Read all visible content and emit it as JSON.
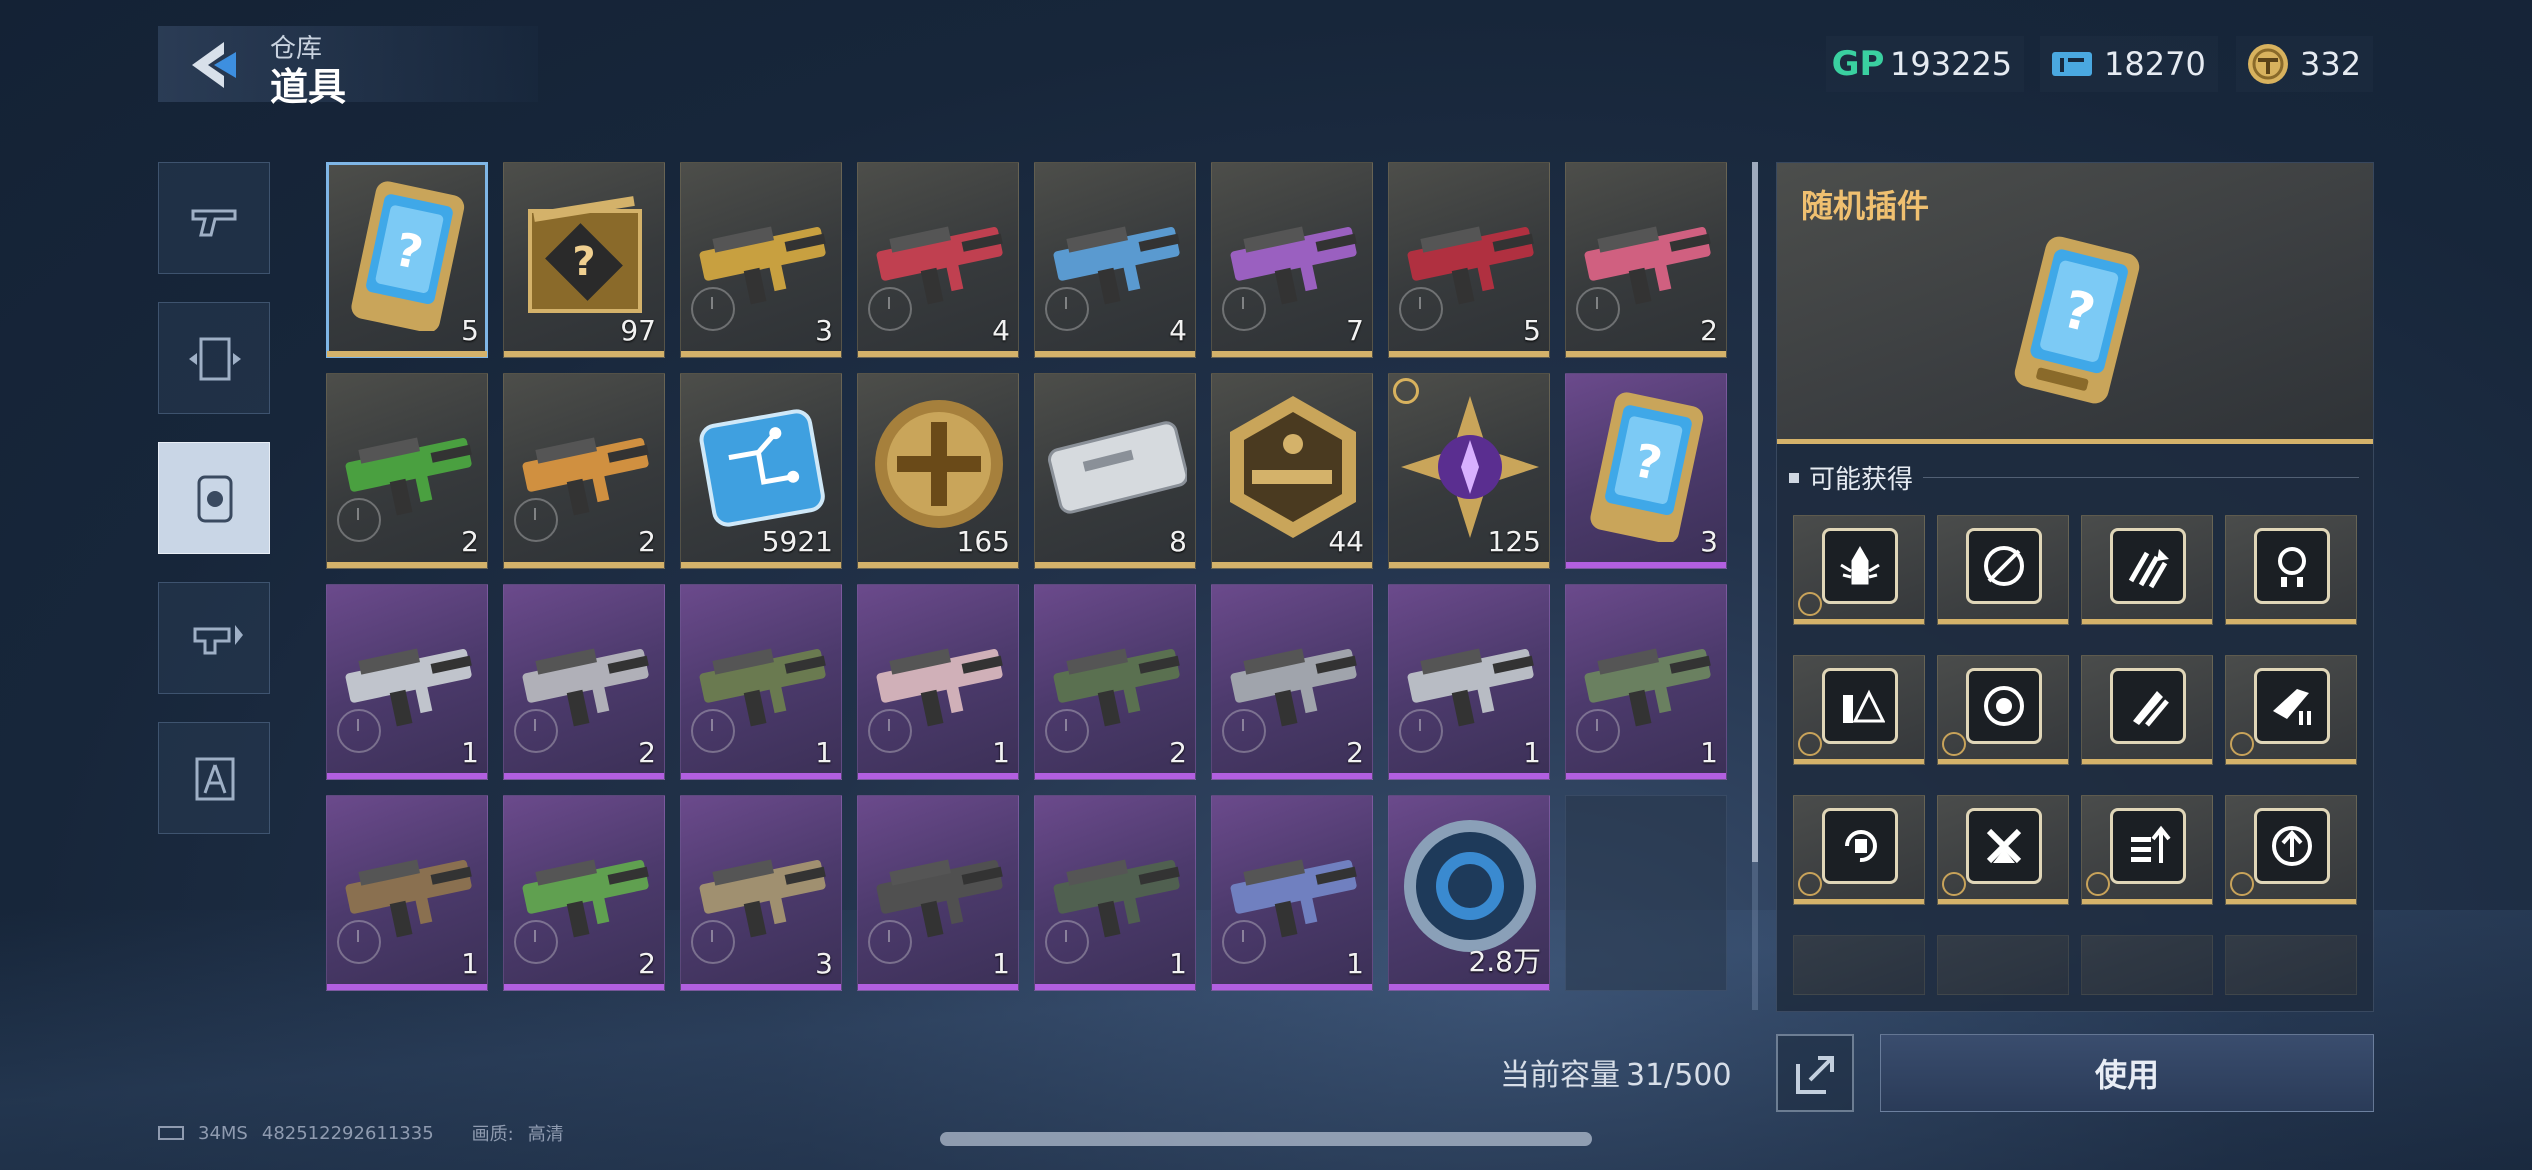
{
  "header": {
    "subtitle": "仓库",
    "title": "道具"
  },
  "currencies": [
    {
      "icon": "gp-icon",
      "label": "GP",
      "value": "193225",
      "color": "#3ad0a0"
    },
    {
      "icon": "ticket-icon",
      "value": "18270",
      "color": "#4aa8e0"
    },
    {
      "icon": "gold-coin-icon",
      "value": "332",
      "color": "#d8b25e"
    }
  ],
  "tabs": [
    {
      "name": "weapon-tab-icon"
    },
    {
      "name": "card-tab-icon"
    },
    {
      "name": "item-tab-icon",
      "active": true
    },
    {
      "name": "attachment-tab-icon"
    },
    {
      "name": "blueprint-tab-icon"
    }
  ],
  "inventory": [
    {
      "kind": "card",
      "rarity": "gold",
      "count": "5",
      "selected": true
    },
    {
      "kind": "blueprint-box",
      "rarity": "gold",
      "count": "97"
    },
    {
      "kind": "gun",
      "rarity": "gold",
      "count": "3",
      "color": "#c8a040"
    },
    {
      "kind": "gun",
      "rarity": "gold",
      "count": "4",
      "color": "#c04050"
    },
    {
      "kind": "gun",
      "rarity": "gold",
      "count": "4",
      "color": "#5a9ad0"
    },
    {
      "kind": "gun",
      "rarity": "gold",
      "count": "7",
      "color": "#9a60c0"
    },
    {
      "kind": "gun",
      "rarity": "gold",
      "count": "5",
      "color": "#b03040"
    },
    {
      "kind": "gun",
      "rarity": "gold",
      "count": "2",
      "color": "#d06080"
    },
    {
      "kind": "gun",
      "rarity": "gold",
      "count": "2",
      "color": "#4aa040"
    },
    {
      "kind": "gun",
      "rarity": "gold",
      "count": "2",
      "color": "#d09040"
    },
    {
      "kind": "chip",
      "rarity": "gold",
      "count": "5921"
    },
    {
      "kind": "coin",
      "rarity": "gold",
      "count": "165"
    },
    {
      "kind": "case",
      "rarity": "gold",
      "count": "8"
    },
    {
      "kind": "hex-badge",
      "rarity": "gold",
      "count": "44"
    },
    {
      "kind": "star",
      "rarity": "gold",
      "count": "125",
      "timer": true
    },
    {
      "kind": "card",
      "rarity": "purple",
      "count": "3"
    },
    {
      "kind": "gun",
      "rarity": "purple",
      "count": "1",
      "color": "#c0c4cc"
    },
    {
      "kind": "gun",
      "rarity": "purple",
      "count": "2",
      "color": "#b0b0b8"
    },
    {
      "kind": "gun",
      "rarity": "purple",
      "count": "1",
      "color": "#6a7a50"
    },
    {
      "kind": "gun",
      "rarity": "purple",
      "count": "1",
      "color": "#d0b0b8"
    },
    {
      "kind": "gun",
      "rarity": "purple",
      "count": "2",
      "color": "#5a7050"
    },
    {
      "kind": "gun",
      "rarity": "purple",
      "count": "2",
      "color": "#a0a4ac"
    },
    {
      "kind": "gun",
      "rarity": "purple",
      "count": "1",
      "color": "#b8bcc4"
    },
    {
      "kind": "gun",
      "rarity": "purple",
      "count": "1",
      "color": "#6a8060"
    },
    {
      "kind": "gun",
      "rarity": "purple",
      "count": "1",
      "color": "#8a7050"
    },
    {
      "kind": "gun",
      "rarity": "purple",
      "count": "2",
      "color": "#60a050"
    },
    {
      "kind": "gun",
      "rarity": "purple",
      "count": "3",
      "color": "#a09070"
    },
    {
      "kind": "gun",
      "rarity": "purple",
      "count": "1",
      "color": "#505050"
    },
    {
      "kind": "gun",
      "rarity": "purple",
      "count": "1",
      "color": "#506050"
    },
    {
      "kind": "gun",
      "rarity": "purple",
      "count": "1",
      "color": "#7080c0"
    },
    {
      "kind": "disc",
      "rarity": "purple",
      "count": "2.8万"
    },
    {
      "kind": "empty"
    }
  ],
  "capacity": {
    "label": "当前容量",
    "value": "31/500"
  },
  "detail": {
    "title": "随机插件",
    "possible_label": "可能获得",
    "rewards": [
      {
        "icon": "bullet-wings-icon",
        "badge": true
      },
      {
        "icon": "no-aim-icon",
        "badge": false
      },
      {
        "icon": "arrow-up-stripes-icon",
        "badge": false
      },
      {
        "icon": "crosshair-bullets-icon",
        "badge": false
      },
      {
        "icon": "bullet-warning-icon",
        "badge": true
      },
      {
        "icon": "target-icon",
        "badge": true
      },
      {
        "icon": "rocket-bullets-icon",
        "badge": false
      },
      {
        "icon": "gun-bullets-icon",
        "badge": true
      },
      {
        "icon": "refresh-bullets-icon",
        "badge": true
      },
      {
        "icon": "x-chevron-icon",
        "badge": true
      },
      {
        "icon": "bullets-up-icon",
        "badge": true
      },
      {
        "icon": "target-up-icon",
        "badge": true
      }
    ]
  },
  "use_button": "使用",
  "footer": {
    "ping": "34MS",
    "uid": "482512292611335",
    "quality_label": "画质:",
    "quality_value": "高清"
  }
}
